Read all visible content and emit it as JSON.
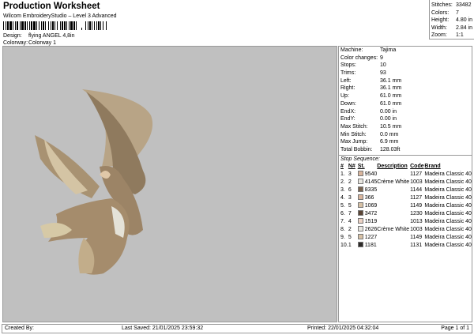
{
  "header": {
    "title": "Production Worksheet",
    "subtitle": "Wilcom EmbroideryStudio – Level 3 Advanced",
    "design_label": "Design:",
    "design": "flying ANGEL 4,8in",
    "colorway_label": "Colorway:",
    "colorway": "Colorway 1"
  },
  "stats": [
    {
      "label": "Stitches:",
      "value": "33482"
    },
    {
      "label": "Colors:",
      "value": "7"
    },
    {
      "label": "Height:",
      "value": "4.80 in"
    },
    {
      "label": "Width:",
      "value": "2.84 in"
    },
    {
      "label": "Zoom:",
      "value": "1:1"
    }
  ],
  "info": [
    {
      "label": "Machine:",
      "value": "Tajima"
    },
    {
      "label": "Color changes:",
      "value": "9"
    },
    {
      "label": "Stops:",
      "value": "10"
    },
    {
      "label": "Trims:",
      "value": "93"
    },
    {
      "label": "Left:",
      "value": "36.1 mm"
    },
    {
      "label": "Right:",
      "value": "36.1 mm"
    },
    {
      "label": "Up:",
      "value": "61.0 mm"
    },
    {
      "label": "Down:",
      "value": "61.0 mm"
    },
    {
      "label": "EndX:",
      "value": "0.00 in"
    },
    {
      "label": "EndY:",
      "value": "0.00 in"
    },
    {
      "label": "Max Stitch:",
      "value": "10.5 mm"
    },
    {
      "label": "Min Stitch:",
      "value": "0.0 mm"
    },
    {
      "label": "Max Jump:",
      "value": "6.9 mm"
    },
    {
      "label": "Total Bobbin:",
      "value": "128.03ft"
    }
  ],
  "stop_sequence": {
    "title": "Stop Sequence:",
    "columns": [
      "#",
      "N#",
      "St.",
      "Description",
      "Code",
      "Brand"
    ],
    "rows": [
      {
        "n": "1.",
        "c": "3",
        "color": "#d9b59c",
        "st": "9540",
        "desc": "",
        "code": "1127",
        "brand": "Madeira Classic 40"
      },
      {
        "n": "2.",
        "c": "2",
        "color": "#e8e6e0",
        "st": "4145",
        "desc": "Crème White",
        "code": "1003",
        "brand": "Madeira Classic 40"
      },
      {
        "n": "3.",
        "c": "6",
        "color": "#7a6450",
        "st": "8335",
        "desc": "",
        "code": "1144",
        "brand": "Madeira Classic 40"
      },
      {
        "n": "4.",
        "c": "3",
        "color": "#d9b59c",
        "st": "366",
        "desc": "",
        "code": "1127",
        "brand": "Madeira Classic 40"
      },
      {
        "n": "5.",
        "c": "5",
        "color": "#d6c0a4",
        "st": "1069",
        "desc": "",
        "code": "1149",
        "brand": "Madeira Classic 40"
      },
      {
        "n": "6.",
        "c": "7",
        "color": "#5a4536",
        "st": "3472",
        "desc": "",
        "code": "1230",
        "brand": "Madeira Classic 40"
      },
      {
        "n": "7.",
        "c": "4",
        "color": "#ecd2c4",
        "st": "1519",
        "desc": "",
        "code": "1013",
        "brand": "Madeira Classic 40"
      },
      {
        "n": "8.",
        "c": "2",
        "color": "#e8e6e0",
        "st": "2626",
        "desc": "Crème White",
        "code": "1003",
        "brand": "Madeira Classic 40"
      },
      {
        "n": "9.",
        "c": "5",
        "color": "#d6c0a4",
        "st": "1227",
        "desc": "",
        "code": "1149",
        "brand": "Madeira Classic 40"
      },
      {
        "n": "10.",
        "c": "1",
        "color": "#2e2a28",
        "st": "1181",
        "desc": "",
        "code": "1131",
        "brand": "Madeira Classic 40"
      }
    ]
  },
  "footer": {
    "created": "Created By:",
    "saved": "Last Saved: 21/01/2025 23:59:32",
    "printed": "Printed: 22/01/2025 04:32:04",
    "page": "Page 1 of 1"
  }
}
